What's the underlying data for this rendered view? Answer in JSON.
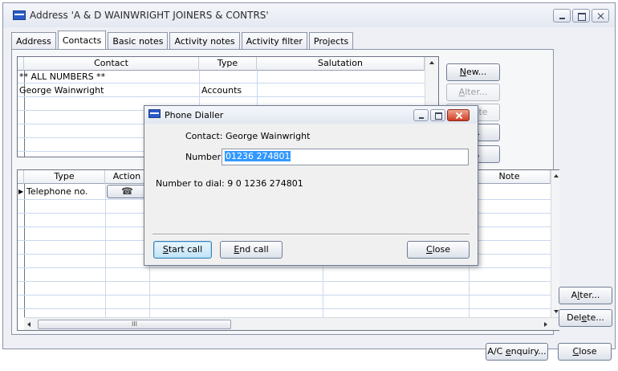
{
  "window": {
    "title": "Address 'A & D WAINWRIGHT JOINERS & CONTRS'"
  },
  "tabs": [
    "Address",
    "Contacts",
    "Basic notes",
    "Activity notes",
    "Activity filter",
    "Projects"
  ],
  "contacts_grid": {
    "columns": [
      "Contact",
      "Type",
      "Salutation"
    ],
    "rows": [
      [
        "** ALL NUMBERS **",
        "",
        ""
      ],
      [
        "George Wainwright",
        "Accounts",
        ""
      ]
    ]
  },
  "contact_buttons": {
    "new": "New...",
    "alter": "Alter...",
    "delete_partial": "Delete",
    "partial_2": "e...",
    "partial_3": "e..."
  },
  "numbers_grid": {
    "columns": [
      "Type",
      "Action",
      "Note"
    ],
    "rows": [
      [
        "Telephone no.",
        "phone-icon",
        ""
      ]
    ],
    "hscroll_label": "III"
  },
  "number_buttons": {
    "alter": "Alter...",
    "delete": "Delete..."
  },
  "footer": {
    "ac_enquiry": "A/C enquiry...",
    "close": "Close"
  },
  "dialog": {
    "title": "Phone Dialler",
    "contact_label": "Contact: George Wainwright",
    "number_label": "Number",
    "number_value": "01236 274801",
    "dial_label": "Number to dial: 9 0 1236 274801",
    "start_call": "Start call",
    "end_call": "End call",
    "close": "Close"
  }
}
